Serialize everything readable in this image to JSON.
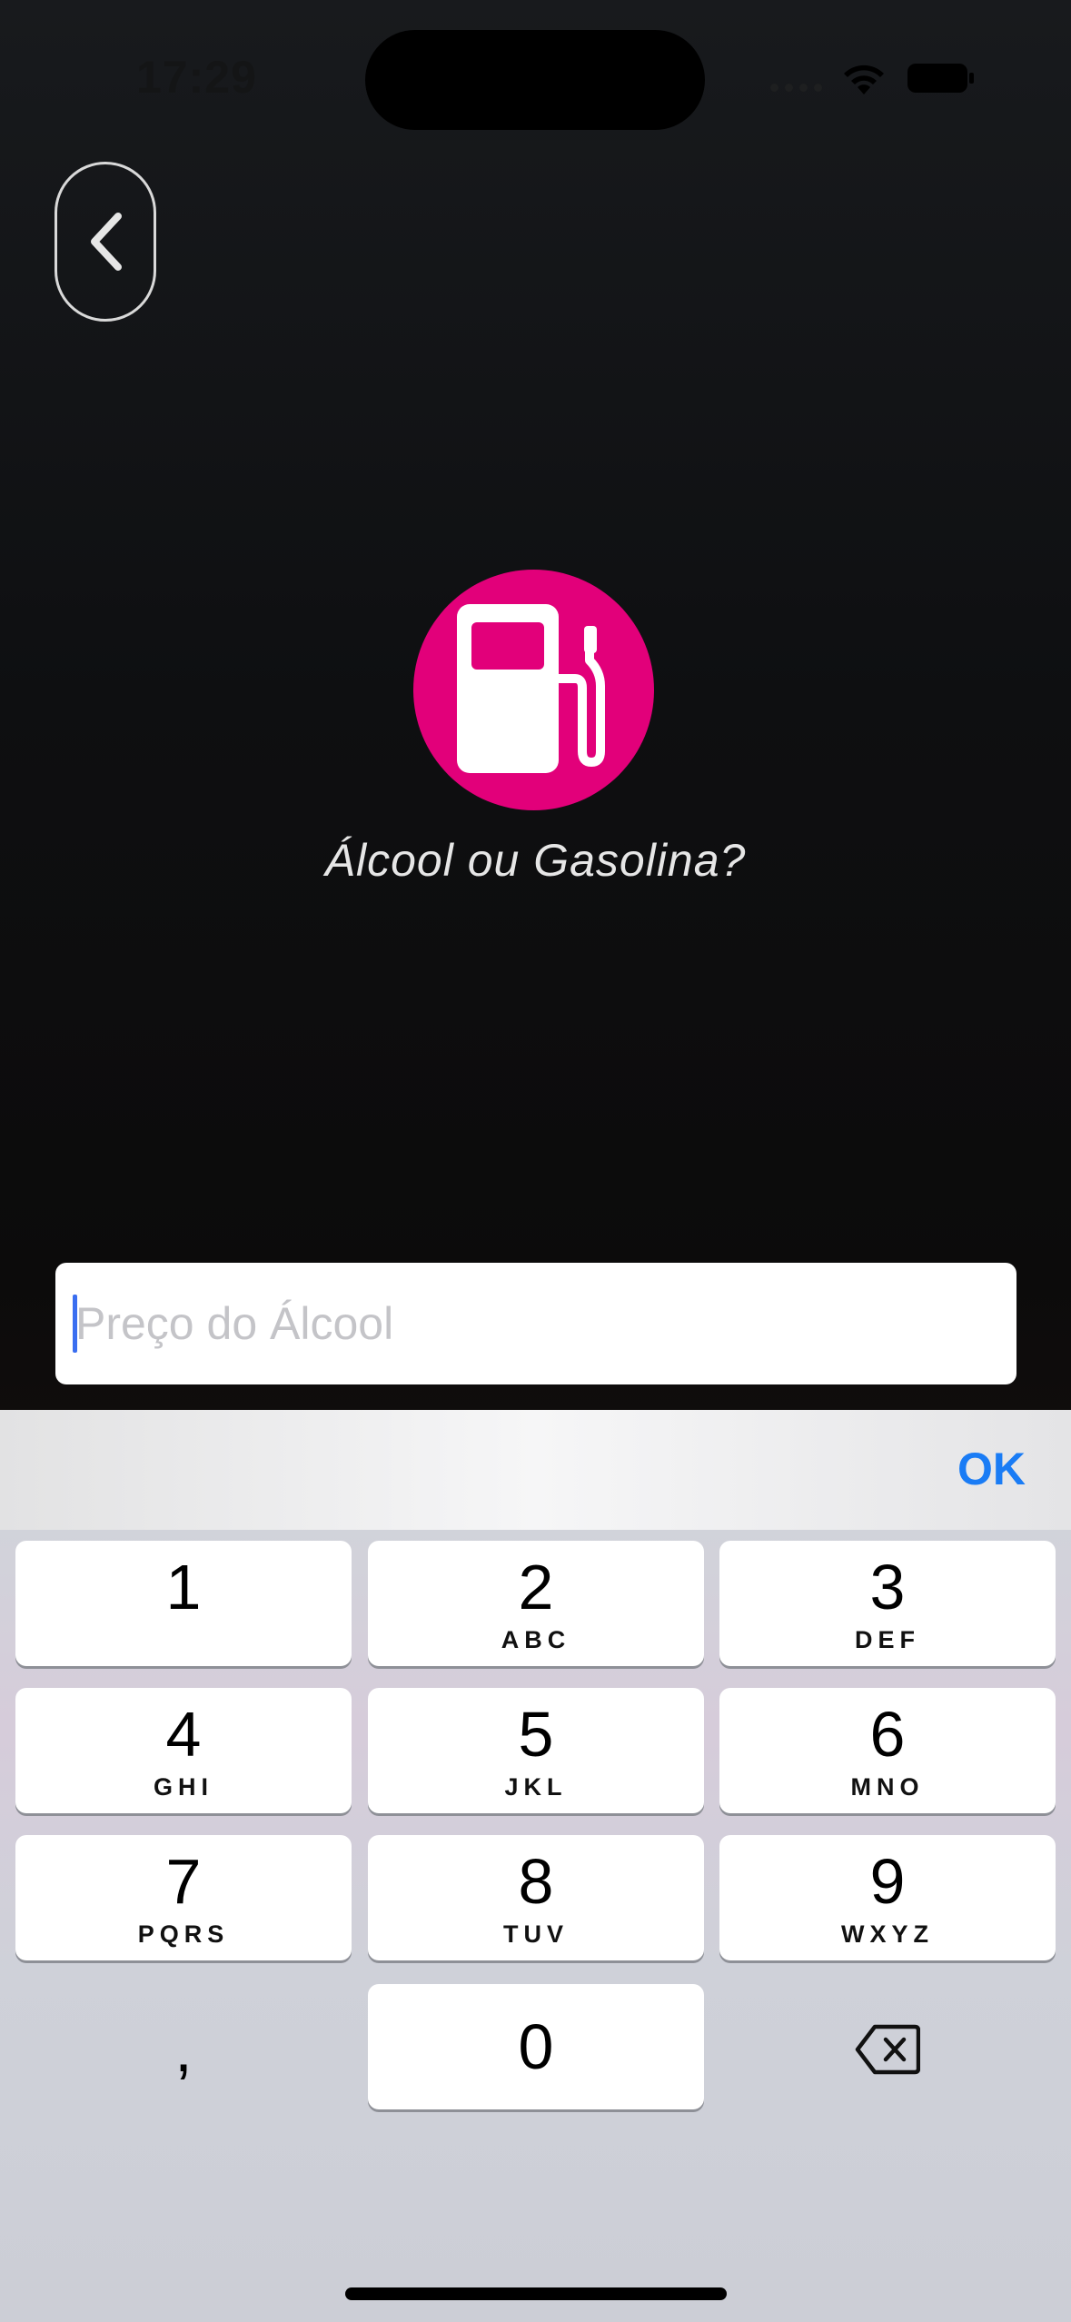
{
  "status_bar": {
    "time": "17:29",
    "icons": [
      "signal-icon",
      "wifi-icon",
      "battery-icon"
    ]
  },
  "nav": {
    "back_icon": "chevron-left-icon"
  },
  "app": {
    "logo_icon": "fuel-pump-icon",
    "title": "Álcool ou Gasolina?",
    "accent_color": "#e2007a"
  },
  "input": {
    "value": "",
    "placeholder": "Preço do Álcool"
  },
  "keyboard": {
    "done_label": "OK",
    "done_color": "#1a7cf5",
    "keys": [
      {
        "digit": "1",
        "letters": ""
      },
      {
        "digit": "2",
        "letters": "ABC"
      },
      {
        "digit": "3",
        "letters": "DEF"
      },
      {
        "digit": "4",
        "letters": "GHI"
      },
      {
        "digit": "5",
        "letters": "JKL"
      },
      {
        "digit": "6",
        "letters": "MNO"
      },
      {
        "digit": "7",
        "letters": "PQRS"
      },
      {
        "digit": "8",
        "letters": "TUV"
      },
      {
        "digit": "9",
        "letters": "WXYZ"
      }
    ],
    "zero": "0",
    "comma": ",",
    "delete_icon": "backspace-icon"
  }
}
